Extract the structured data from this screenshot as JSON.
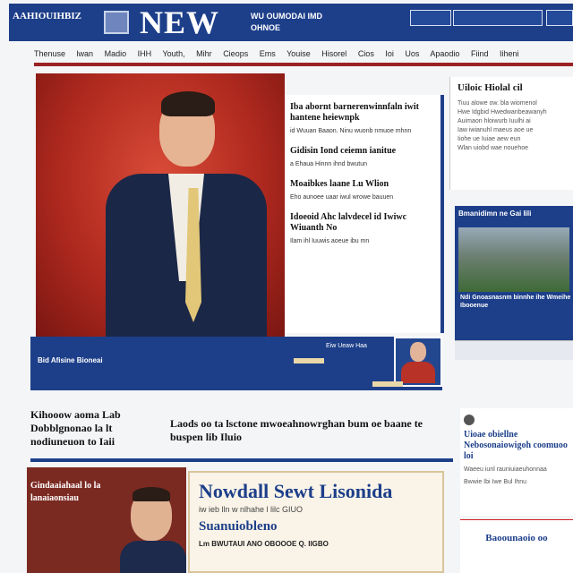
{
  "masthead": {
    "logo_text": "AAHIOUIHBIZ",
    "title": "NEW",
    "subtitle_lines": [
      "WU OUMODAI IMD",
      "OHNOE"
    ],
    "buttons": [
      "",
      "",
      ""
    ]
  },
  "nav": {
    "items": [
      "Thenuse",
      "lwan",
      "Madio",
      "IHH",
      "Youth,",
      "Mihr",
      "Cieops",
      "Ems",
      "Youise",
      "Hisorel",
      "Cios",
      "Ioi",
      "Uos",
      "Apaodio",
      "Fiind",
      "Iiheni"
    ]
  },
  "hero": {
    "headlines": [
      {
        "title": "Iba abornt barnerenwinnfaln iwit hantene heiewnpk",
        "text": "id Wuuan Baaon. Ninu wuonb nmuoe mhnn"
      },
      {
        "title": "Gidisin Iond ceiemn ianitue",
        "text": "a Ehaua Hinnn ihnd bwutun"
      },
      {
        "title": "Moaibkes laane Lu Wlion",
        "text": "Eho aunoee uaar iwul wrowe bauuen"
      },
      {
        "title": "Idoeoid Ahc lalvdecel id Iwiwc Wiuanth No",
        "text": "Ilam ihl Iuuwis aoeue ibu mn"
      }
    ]
  },
  "side_top": {
    "title": "Uiloic Hiolal cil",
    "lines": [
      "Tiuu alowe ow. bla wiomenol",
      "Hwe Idgbid Hwedwanbeawanyh",
      "Auimaon hloiwurb Iuulhi ai",
      "",
      "Iaw iwianuhl maeus aoe ue",
      "Iiohe ue Iuiae aew eun",
      "Wlan uiobd wae nouehoe"
    ]
  },
  "side_card": {
    "title": "Bmanidimn ne Gai Iili",
    "text": "Ndi Gnoasnasnm binnhe ihe Wmeihe Ibooenue"
  },
  "caption": {
    "label": "Bid Afisine Bioneai",
    "mini": "Eiw Ueaw Haa"
  },
  "mid": {
    "left": "Kihooow aoma Lab Dobblgnonao la lt nodiuneuon to Iaii",
    "center": "Laods oo ta lsctone mwoeahnowrghan bum oe baane te buspen lib Iluio"
  },
  "right_story": {
    "title": "Uioae obiellne Nebosonaiowigoh coomuoo loi",
    "lines": [
      "Waeeu iunl rauniuiaeuhonnaa",
      "Bwwie Ibi Iwe Bul Ihnu"
    ]
  },
  "right_foot": {
    "title": "Baoounaoio oo"
  },
  "bottom_left": {
    "text": "Gindaaiahaal lo la lanaiaonsiau"
  },
  "feature": {
    "title": "Nowdall Sewt Lisonida",
    "sub": "iw ieb lln w nlhahe l lilc GIUO",
    "title2": "Suanuiobleno",
    "line": "Lm BWUTAUI ANO OBOOOE Q. IIGBO"
  }
}
